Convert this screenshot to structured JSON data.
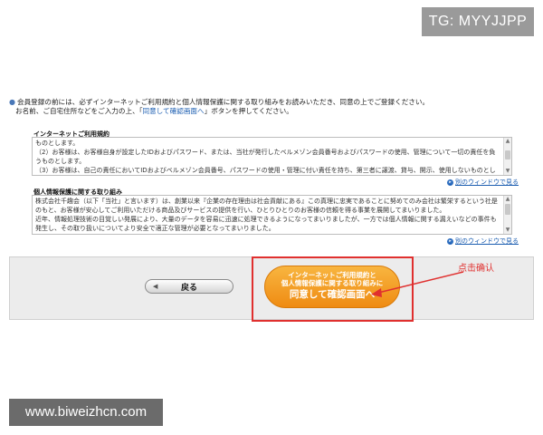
{
  "watermark_top": "TG: MYYJJPP",
  "intro": {
    "line1": "会員登録の前には、必ずインターネットご利用規約と個人情報保護に関する取り組みをお読みいただき、同意の上でご登録ください。",
    "line2_before": "お名前、ご自宅住所などをご入力の上、「",
    "line2_link": "同意して確認画面へ",
    "line2_after": "」ボタンを押してください。"
  },
  "terms": {
    "title": "インターネットご利用規約",
    "lines": [
      "ものとします。",
      "（2）お客様は、お客様自身が設定したIDおよびパスワード、または、当社が発行したベルメゾン会員番号およびパスワードの使用、管理について一切の責任を負うものとします。",
      "（3）お客様は、自己の責任においてIDおよびベルメゾン会員番号、パスワードの使用・管理に付い責任を持ち、第三者に譲渡、貸与、開示、使用しないものとします。"
    ],
    "newwin_label": "別のウィンドウで見る"
  },
  "privacy": {
    "title": "個人情報保護に関する取り組み",
    "lines": [
      "株式会社千趣会（以下「当社」と言います）は、創業以来『企業の存在理由は社会貢献にある』この真理に忠実であることに努めてのみ会社は繁栄するという社是のもと、お客様が安心してご利用いただける商品及びサービスの提供を行い、ひとりひとりのお客様の信頼を得る事業を展開してまいりました。",
      "近年、情報処理技術の目覚しい発展により、大量のデータを容易に迅速に処理できるようになってまいりましたが、一方では個人情報に関する漏えいなどの事件も発生し、その取り扱いについてより安全で適正な管理が必要となってまいりました。"
    ],
    "newwin_label": "別のウィンドウで見る"
  },
  "buttons": {
    "back": "戻る",
    "agree_line1": "インターネットご利用規約と",
    "agree_line2": "個人情報保護に関する取り組みに",
    "agree_line3": "同意して確認画面へ"
  },
  "annotation": {
    "text": "点击确认",
    "color": "#e0302f"
  },
  "watermark_bottom": "www.biweizhcn.com",
  "colors": {
    "agree_button": "#f29a1e",
    "link": "#1a5cb0"
  }
}
